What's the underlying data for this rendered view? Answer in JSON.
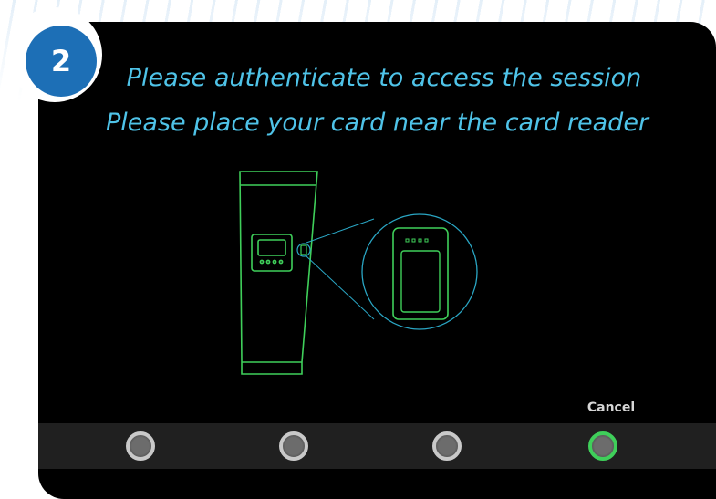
{
  "step": {
    "number": "2"
  },
  "prompt": {
    "line1": "Please authenticate to access the session",
    "line2": "Please place your card near the card reader"
  },
  "illustration": {
    "name": "card-reader-terminal"
  },
  "buttons": {
    "cancel_label": "Cancel",
    "items": [
      {
        "name": "hardware-button-1",
        "active": false
      },
      {
        "name": "hardware-button-2",
        "active": false
      },
      {
        "name": "hardware-button-3",
        "active": false
      },
      {
        "name": "hardware-button-4-cancel",
        "active": true
      }
    ]
  },
  "colors": {
    "screen_background": "#000000",
    "prompt_text": "#4fc3e8",
    "badge_fill": "#1d6fb6",
    "device_outline": "#3fcf5a",
    "zoom_outline": "#2aa6c4",
    "active_button_ring": "#3fcf5a",
    "button_bar": "#202020"
  }
}
